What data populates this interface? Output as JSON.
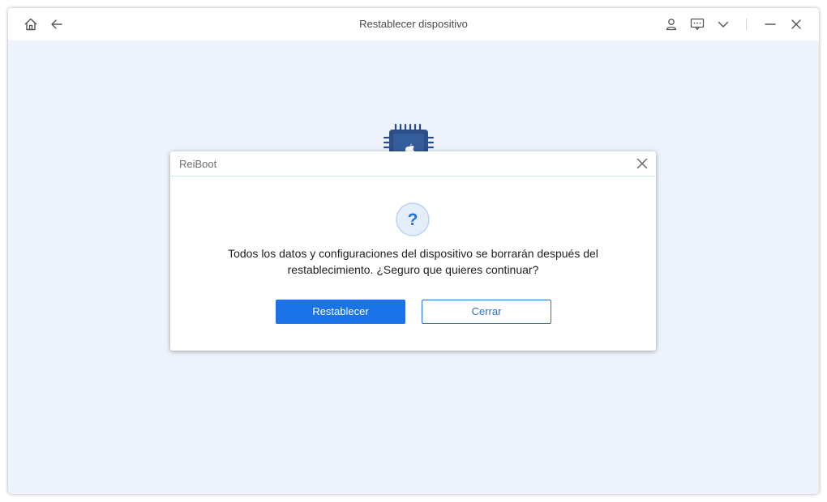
{
  "window": {
    "title": "Restablecer dispositivo"
  },
  "titlebar": {
    "icons": {
      "home": "home-icon",
      "back": "arrow-left-icon",
      "account": "user-icon",
      "feedback": "chat-icon",
      "menu": "chevron-down-icon",
      "minimize": "minimize-icon",
      "close": "close-icon"
    }
  },
  "dialog": {
    "title": "ReiBoot",
    "icon": "question-icon",
    "message_line1": "Todos los datos y configuraciones del dispositivo se borrarán después del",
    "message_line2": "restablecimiento. ¿Seguro que quieres continuar?",
    "confirm_label": "Restablecer",
    "cancel_label": "Cerrar"
  },
  "colors": {
    "accent": "#1a73e8",
    "background": "#eef2fa",
    "chip": "#2b4f86"
  }
}
